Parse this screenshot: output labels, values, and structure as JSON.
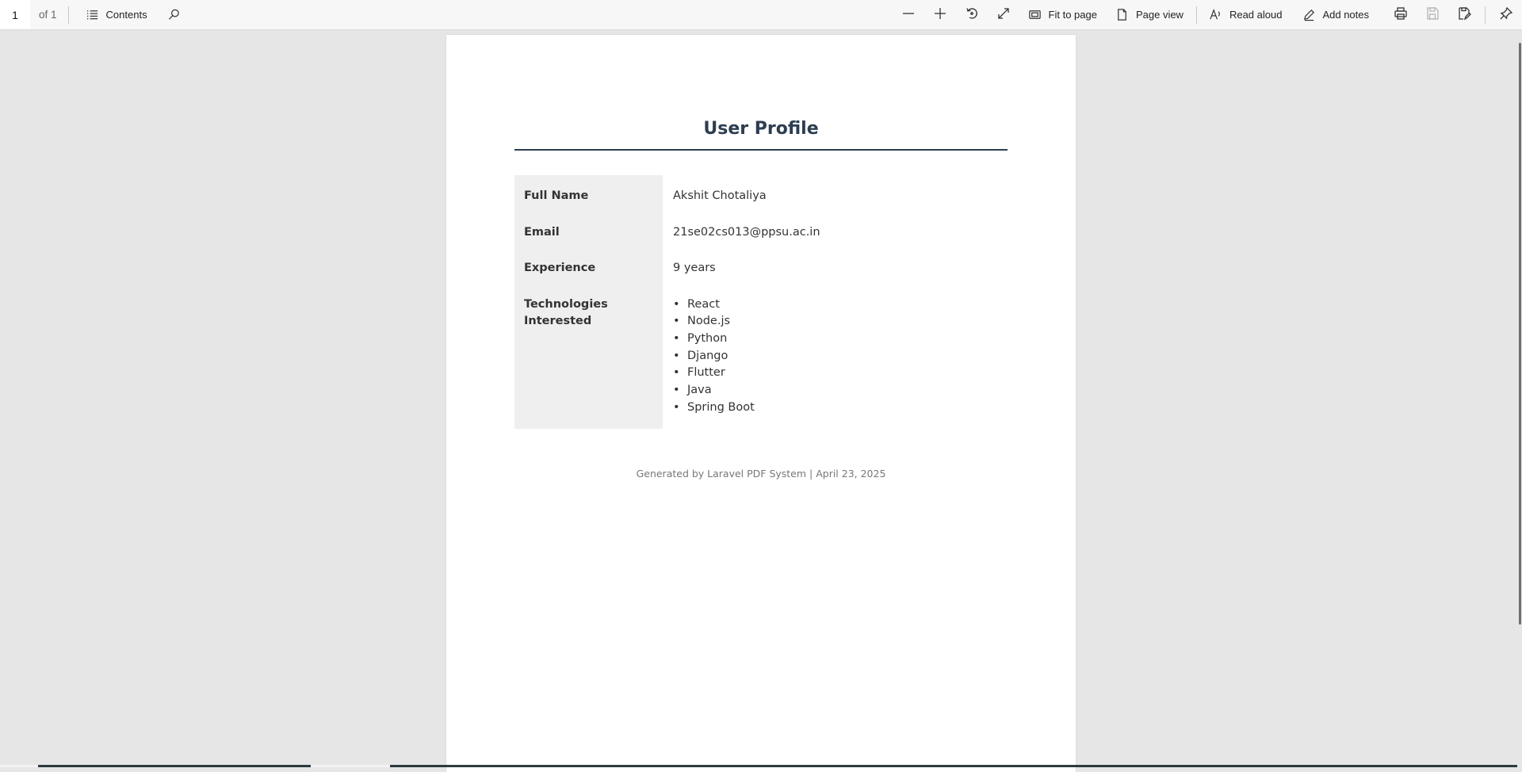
{
  "toolbar": {
    "page_number": "1",
    "page_of": "of 1",
    "contents_label": "Contents",
    "fit_to_page_label": "Fit to page",
    "page_view_label": "Page view",
    "read_aloud_label": "Read aloud",
    "add_notes_label": "Add notes",
    "icons": [
      "contents-icon",
      "search-icon",
      "zoom-out-icon",
      "zoom-in-icon",
      "rotate-icon",
      "fullscreen-icon",
      "fit-to-page-icon",
      "page-view-icon",
      "read-aloud-icon",
      "add-notes-icon",
      "print-icon",
      "save-icon",
      "save-as-icon",
      "pin-icon"
    ]
  },
  "document": {
    "title": "User Profile",
    "title_color": "#2c3e50",
    "rows": [
      {
        "label": "Full Name",
        "value": "Akshit Chotaliya"
      },
      {
        "label": "Email",
        "value": "21se02cs013@ppsu.ac.in"
      },
      {
        "label": "Experience",
        "value": "9 years"
      }
    ],
    "technologies_label": "Technologies Interested",
    "technologies": [
      "React",
      "Node.js",
      "Python",
      "Django",
      "Flutter",
      "Java",
      "Spring Boot"
    ],
    "footer": "Generated by Laravel PDF System | April 23, 2025"
  }
}
